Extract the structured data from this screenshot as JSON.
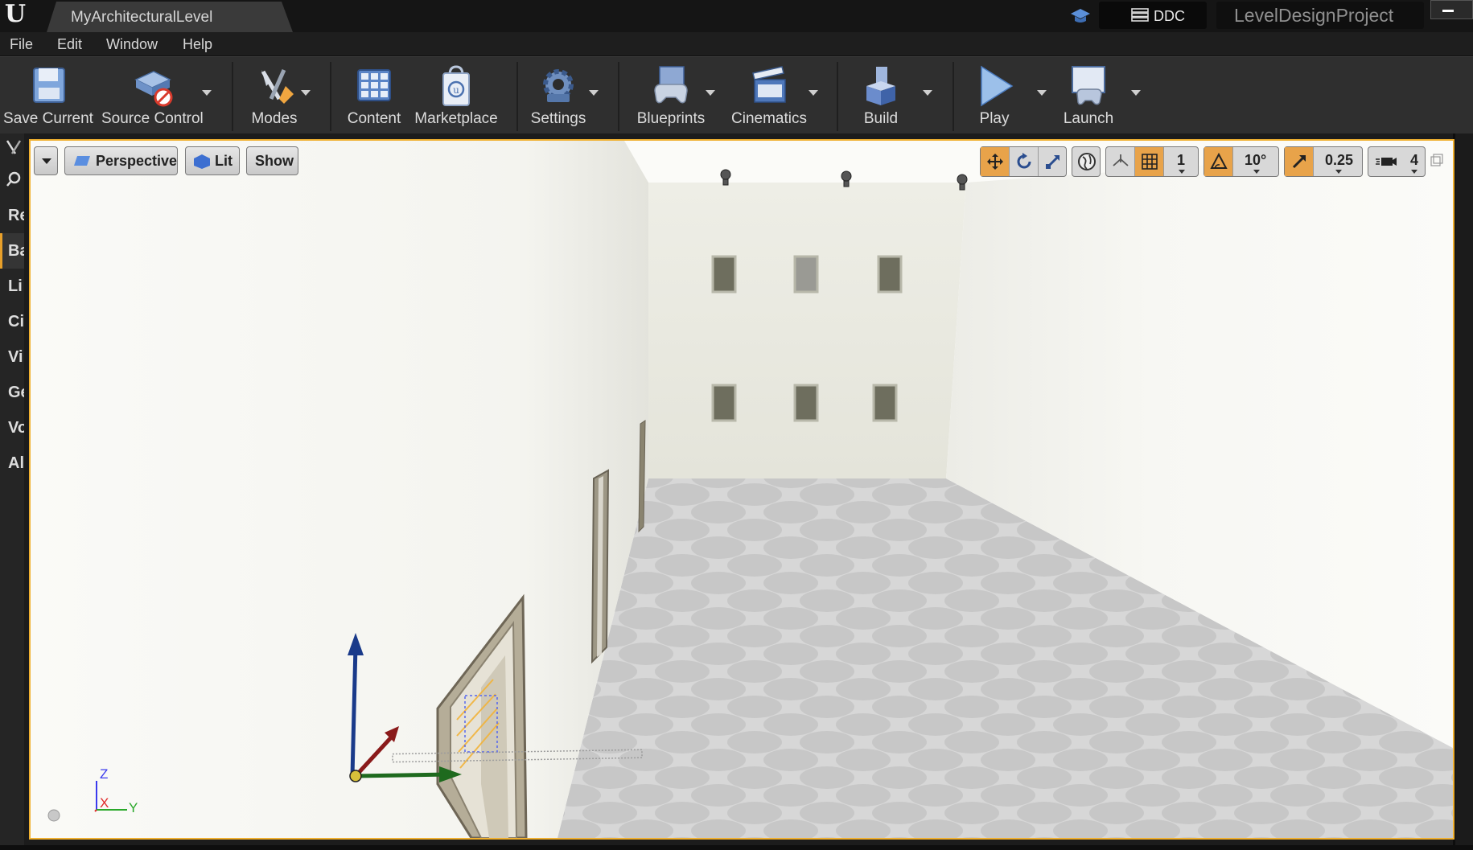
{
  "titlebar": {
    "logo_text": "U",
    "level_tab": "MyArchitecturalLevel",
    "ddc_label": "DDC",
    "project_name": "LevelDesignProject"
  },
  "menu": [
    "File",
    "Edit",
    "Window",
    "Help"
  ],
  "toolbar": {
    "save_current": "Save Current",
    "source_control": "Source Control",
    "modes": "Modes",
    "content": "Content",
    "marketplace": "Marketplace",
    "settings": "Settings",
    "blueprints": "Blueprints",
    "cinematics": "Cinematics",
    "build": "Build",
    "play": "Play",
    "launch": "Launch"
  },
  "left_panel": {
    "items": [
      "Re",
      "Ba",
      "Li",
      "Ci",
      "Vi",
      "Ge",
      "Vo",
      "Al"
    ],
    "active_index": 1
  },
  "viewport": {
    "perspective_label": "Perspective",
    "lit_label": "Lit",
    "show_label": "Show",
    "grid_snap_value": "1",
    "rotation_snap_value": "10°",
    "scale_snap_value": "0.25",
    "camera_speed_value": "4",
    "axis_labels": {
      "z": "Z",
      "x": "X",
      "y": "Y"
    }
  },
  "colors": {
    "accent_orange": "#e8a34a",
    "viewport_border": "#f0b030",
    "toolbar_bg": "#2f2f2f"
  }
}
